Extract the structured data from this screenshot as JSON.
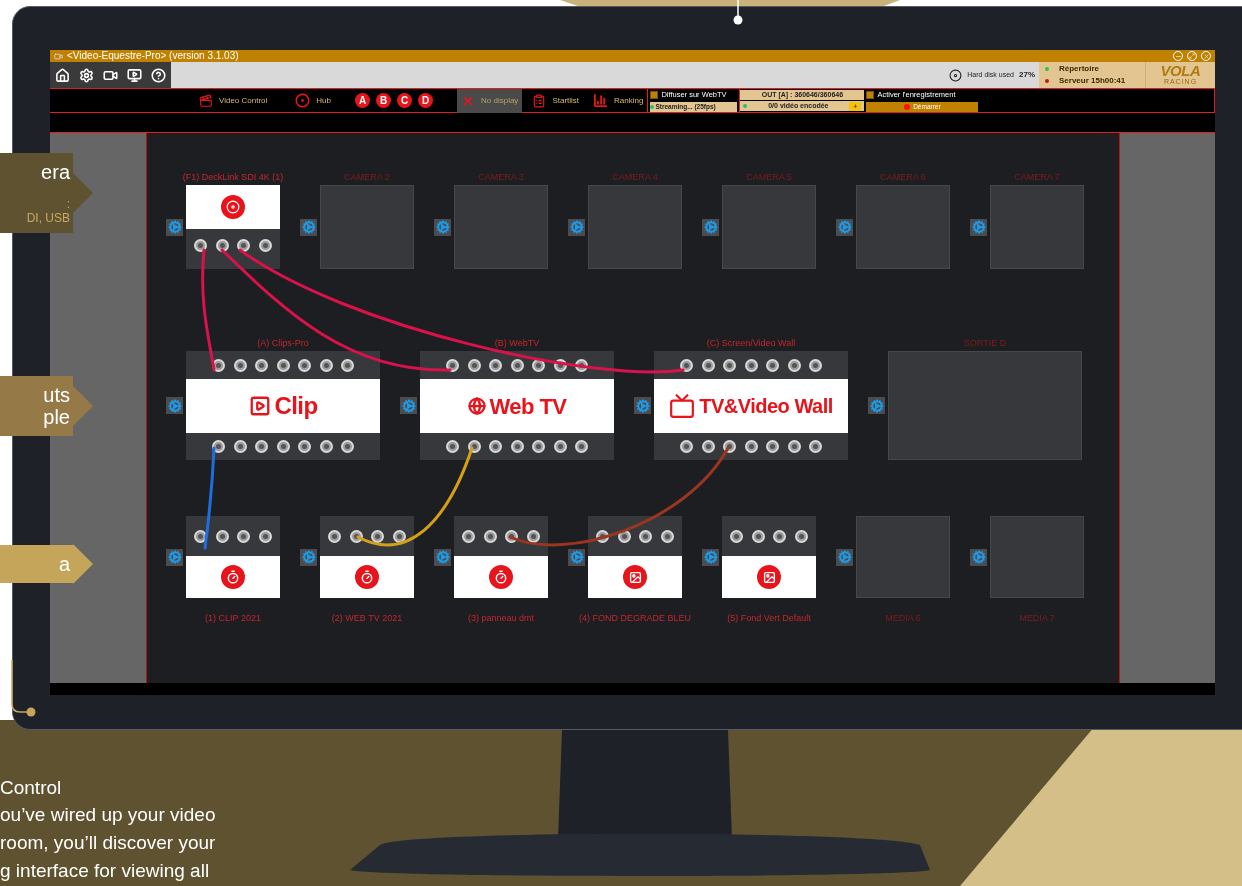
{
  "marketing": {
    "callouts": [
      {
        "title_lines": [
          "era"
        ],
        "detail_lines": [
          ":",
          "DI, USB"
        ],
        "color": "#5f5230"
      },
      {
        "title_lines": [
          "uts",
          "ple"
        ],
        "color": "#957a48"
      },
      {
        "title_lines": [
          "a"
        ],
        "color": "#c4a55a"
      }
    ],
    "description": {
      "title": "Control",
      "lines": [
        "ou’ve wired up your video",
        "room, you’ll discover your",
        "g interface for viewing all"
      ]
    }
  },
  "app": {
    "window": {
      "title": "<Video-Equestre-Pro> (version 3.1.03)"
    },
    "disk": {
      "label": "Hard disk used",
      "value": "27%"
    },
    "server_status": [
      {
        "label": "Répertoire",
        "color": "#22c55e"
      },
      {
        "label": "Serveur 15h00:41",
        "color": "#b91c1c"
      }
    ],
    "logo": {
      "text": "VOLA",
      "subtext": "RACING"
    },
    "menu": [
      {
        "kind": "video-control",
        "label": "Video Control",
        "disabled": false
      },
      {
        "kind": "hub",
        "label": "Hub",
        "disabled": false
      },
      {
        "kind": "letter",
        "label": "A",
        "disabled": false
      },
      {
        "kind": "letter",
        "label": "B",
        "disabled": false
      },
      {
        "kind": "letter",
        "label": "C",
        "disabled": false
      },
      {
        "kind": "letter",
        "label": "D",
        "disabled": false
      },
      {
        "kind": "no-display",
        "label": "No display",
        "disabled": true
      },
      {
        "kind": "startlist",
        "label": "Startlist",
        "disabled": false
      },
      {
        "kind": "ranking",
        "label": "Ranking",
        "disabled": false
      }
    ],
    "webtv": {
      "label": "Diffuser sur WebTV",
      "checked": false,
      "status": "Streaming... (25fps)"
    },
    "output_counter": {
      "text": "OUT [A] : 360646/360646",
      "encoded": "0/0 vidéo encodée",
      "add": "+"
    },
    "recording": {
      "label": "Activer l'enregistrement",
      "checked": false,
      "start": "Démarrer"
    },
    "cameras": [
      {
        "label": "(F1) DeckLink SDI 4K (1)",
        "kind": "device"
      },
      {
        "label": "CAMERA 2",
        "kind": "empty"
      },
      {
        "label": "CAMERA 3",
        "kind": "empty"
      },
      {
        "label": "CAMERA 4",
        "kind": "empty"
      },
      {
        "label": "CAMERA 5",
        "kind": "empty"
      },
      {
        "label": "CAMERA 6",
        "kind": "empty"
      },
      {
        "label": "CAMERA 7",
        "kind": "empty"
      }
    ],
    "outputs": [
      {
        "label": "(A) Clips-Pro",
        "kind": "clip",
        "logo": "Clip"
      },
      {
        "label": "(B) WebTV",
        "kind": "webtv",
        "logo": "Web TV"
      },
      {
        "label": "(C) Screen/Video Wall",
        "kind": "wall",
        "logo": "TV&Video Wall"
      },
      {
        "label": "SORTIE D",
        "kind": "empty"
      }
    ],
    "media": [
      {
        "label": "(1) CLIP 2021",
        "kind": "timer"
      },
      {
        "label": "(2) WEB TV 2021",
        "kind": "timer"
      },
      {
        "label": "(3) panneau dmt",
        "kind": "timer"
      },
      {
        "label": "(4) FOND DEGRADE BLEU",
        "kind": "image"
      },
      {
        "label": "(5) Fond Vert Default",
        "kind": "image"
      },
      {
        "label": "MEDIA 6",
        "kind": "empty"
      },
      {
        "label": "MEDIA 7",
        "kind": "empty"
      }
    ]
  }
}
